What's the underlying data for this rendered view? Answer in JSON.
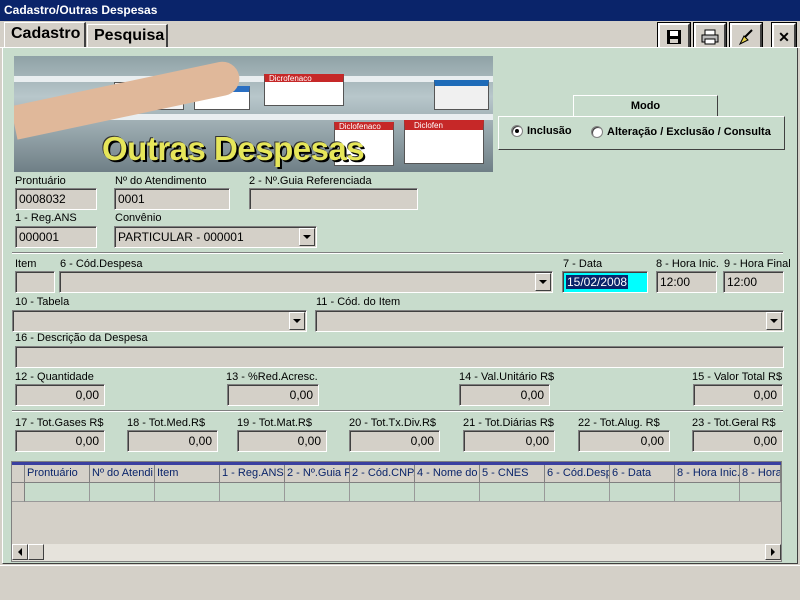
{
  "window": {
    "title": "Cadastro/Outras Despesas"
  },
  "tabs": [
    {
      "label": "Cadastro",
      "active": true
    },
    {
      "label": "Pesquisa",
      "active": false
    }
  ],
  "toolbar": {
    "icons": [
      "save-icon",
      "print-icon",
      "clear-brush-icon",
      "close-icon"
    ],
    "close_glyph": "✕"
  },
  "banner": {
    "title": "Outras Despesas",
    "box_labels": [
      "Dicrofenaco",
      "Diclofenaco",
      "Diclofen"
    ]
  },
  "modo": {
    "title": "Modo",
    "options": [
      {
        "label": "Inclusão",
        "selected": true
      },
      {
        "label": "Alteração / Exclusão / Consulta",
        "selected": false
      }
    ]
  },
  "form": {
    "prontuario": {
      "label": "Prontuário",
      "value": "0008032"
    },
    "atendimento": {
      "label": "Nº do Atendimento",
      "value": "0001"
    },
    "guia": {
      "label": "2 - Nº.Guia Referenciada",
      "value": ""
    },
    "reg_ans": {
      "label": "1 - Reg.ANS",
      "value": "000001"
    },
    "convenio": {
      "label": "Convênio",
      "value": "PARTICULAR - 000001"
    },
    "item": {
      "label": "Item",
      "value": ""
    },
    "cod_despesa": {
      "label": "6 - Cód.Despesa",
      "value": ""
    },
    "data": {
      "label": "7 - Data",
      "value": "15/02/2008"
    },
    "hora_inic": {
      "label": "8 - Hora Inic.",
      "value": "12:00"
    },
    "hora_final": {
      "label": "9 - Hora Final",
      "value": "12:00"
    },
    "tabela": {
      "label": "10 - Tabela",
      "value": ""
    },
    "cod_item": {
      "label": "11 - Cód. do Item",
      "value": ""
    },
    "descricao": {
      "label": "16 - Descrição da Despesa",
      "value": ""
    },
    "quantidade": {
      "label": "12 - Quantidade",
      "value": "0,00"
    },
    "red_acresc": {
      "label": "13 - %Red.Acresc.",
      "value": "0,00"
    },
    "val_unitario": {
      "label": "14 - Val.Unitário R$",
      "value": "0,00"
    },
    "valor_total": {
      "label": "15 - Valor Total R$",
      "value": "0,00"
    }
  },
  "totals": [
    {
      "label": "17 - Tot.Gases R$",
      "value": "0,00"
    },
    {
      "label": "18 - Tot.Med.R$",
      "value": "0,00"
    },
    {
      "label": "19 - Tot.Mat.R$",
      "value": "0,00"
    },
    {
      "label": "20 - Tot.Tx.Div.R$",
      "value": "0,00"
    },
    {
      "label": "21 - Tot.Diárias R$",
      "value": "0,00"
    },
    {
      "label": "22 - Tot.Alug. R$",
      "value": "0,00"
    },
    {
      "label": "23 - Tot.Geral R$",
      "value": "0,00"
    }
  ],
  "grid": {
    "columns": [
      "Prontuário",
      "Nº do Atendi",
      "Item",
      "1 - Reg.ANS",
      "2 - Nº.Guia R",
      "2 - Cód.CNP.",
      "4 - Nome do",
      "5 - CNES",
      "6 - Cód.Desp",
      "6 - Data",
      "8 - Hora Inic.",
      "8 - Hora"
    ]
  },
  "colors": {
    "panel": "#c8dccc",
    "titlebar": "#0a246a",
    "selected_date": "#00ffff"
  }
}
